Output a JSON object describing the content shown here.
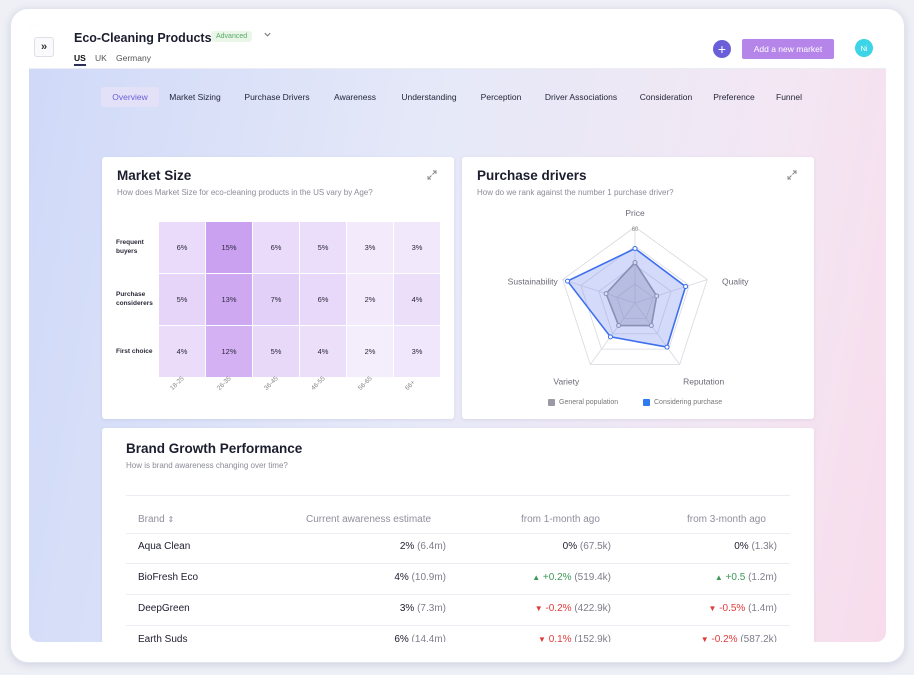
{
  "header": {
    "title": "Eco-Cleaning Products",
    "badge": "Advanced",
    "markets": [
      "US",
      "UK",
      "Germany"
    ],
    "add_market_label": "Add a new market",
    "avatar_initials": "Ni",
    "expand_glyph": "»",
    "plus_glyph": "+"
  },
  "tabs": [
    "Overview",
    "Market Sizing",
    "Purchase Drivers",
    "Awareness",
    "Understanding",
    "Perception",
    "Driver Associations",
    "Consideration",
    "Preference",
    "Funnel"
  ],
  "market_size": {
    "title": "Market Size",
    "subtitle": "How does Market Size for eco-cleaning products in the US vary by Age?",
    "rows": [
      "Frequent buyers",
      "Purchase considerers",
      "First choice"
    ],
    "cols": [
      "18-25",
      "26-35",
      "36-45",
      "46-55",
      "56-65",
      "66+"
    ],
    "values": [
      [
        6,
        15,
        6,
        5,
        3,
        3
      ],
      [
        5,
        13,
        7,
        6,
        2,
        4
      ],
      [
        4,
        12,
        5,
        4,
        2,
        3
      ]
    ],
    "cell_colors": [
      [
        "#eadbfa",
        "#caa0f1",
        "#eadbfa",
        "#ebdefa",
        "#f3ebfc",
        "#f1e8fc"
      ],
      [
        "#e7d5f9",
        "#cfa8f2",
        "#e3d0f8",
        "#e8d8f9",
        "#f3ebfc",
        "#ecdffa"
      ],
      [
        "#ebdcfa",
        "#d4b1f3",
        "#e9d9f9",
        "#ecdffa",
        "#f4edfc",
        "#f1e7fc"
      ]
    ]
  },
  "purchase_drivers": {
    "title": "Purchase drivers",
    "subtitle": "How do we rank against the number 1 purchase driver?",
    "axes": [
      "Price",
      "Quality",
      "Reputation",
      "Variety",
      "Sustainability"
    ],
    "scale_label": "60",
    "series": [
      {
        "name": "General population",
        "values": [
          32,
          18,
          22,
          22,
          24
        ],
        "color": "#9a9aa4"
      },
      {
        "name": "Considering purchase",
        "values": [
          43,
          42,
          43,
          33,
          56
        ],
        "color": "#3d6fef"
      }
    ]
  },
  "brand_growth": {
    "title": "Brand Growth Performance",
    "subtitle": "How is brand awareness changing over time?",
    "headers": [
      "Brand",
      "Current awareness estimate",
      "from 1-month ago",
      "from 3-month ago"
    ],
    "sort_glyph": "⇕",
    "rows": [
      {
        "brand": "Aqua Clean",
        "current": "2%",
        "current_abs": "(6.4m)",
        "m1": "0%",
        "m1_abs": "(67.5k)",
        "m1_dir": "none",
        "m3": "0%",
        "m3_abs": "(1.3k)",
        "m3_dir": "none"
      },
      {
        "brand": "BioFresh Eco",
        "current": "4%",
        "current_abs": "(10.9m)",
        "m1": "+0.2%",
        "m1_abs": "(519.4k)",
        "m1_dir": "up",
        "m3": "+0.5",
        "m3_abs": "(1.2m)",
        "m3_dir": "up"
      },
      {
        "brand": "DeepGreen",
        "current": "3%",
        "current_abs": "(7.3m)",
        "m1": "-0.2%",
        "m1_abs": "(422.9k)",
        "m1_dir": "down",
        "m3": "-0.5%",
        "m3_abs": "(1.4m)",
        "m3_dir": "down"
      },
      {
        "brand": "Earth Suds",
        "current": "6%",
        "current_abs": "(14.4m)",
        "m1": "0.1%",
        "m1_abs": "(152.9k)",
        "m1_dir": "down",
        "m3": "-0.2%",
        "m3_abs": "(587.2k)",
        "m3_dir": "down"
      }
    ]
  }
}
